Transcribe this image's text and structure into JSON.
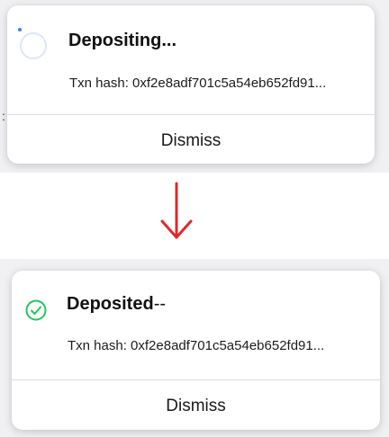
{
  "pending_toast": {
    "title": "Depositing...",
    "hash_label": "Txn hash:",
    "hash_value": "0xf2e8adf701c5a54eb652fd91...",
    "dismiss_label": "Dismiss",
    "status_icon": "loading-spinner-icon"
  },
  "transition": {
    "icon": "arrow-down-icon",
    "color": "#e0282e"
  },
  "success_toast": {
    "title": "Deposited",
    "title_suffix": "--",
    "hash_label": "Txn hash:",
    "hash_value": "0xf2e8adf701c5a54eb652fd91...",
    "dismiss_label": "Dismiss",
    "status_icon": "check-circle-icon",
    "status_color": "#22c55e"
  }
}
